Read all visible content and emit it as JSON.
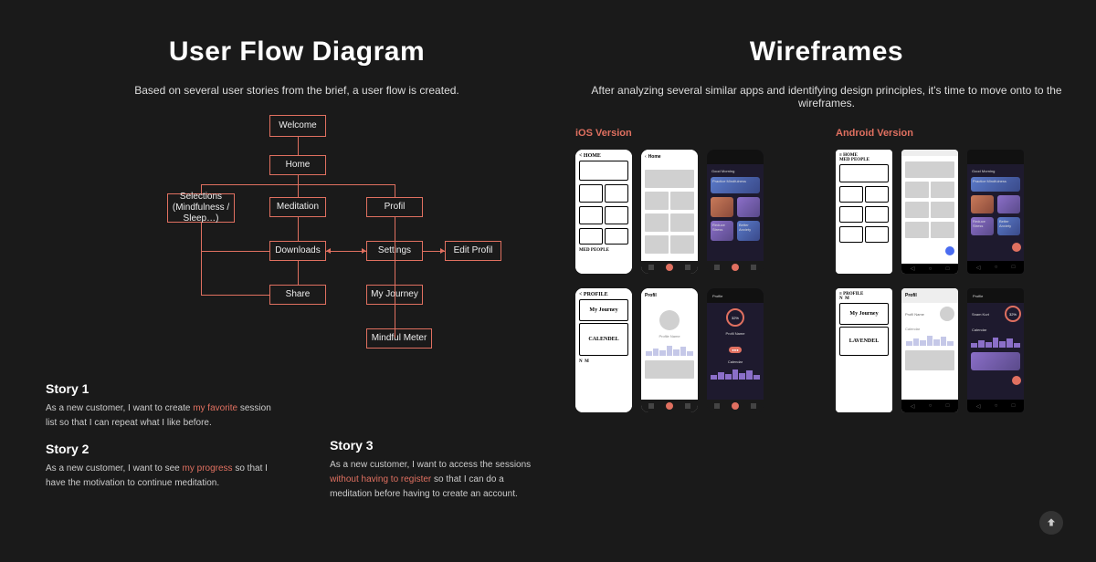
{
  "left": {
    "title": "User Flow Diagram",
    "subtitle": "Based on several user stories from the brief, a user flow is created.",
    "nodes": {
      "welcome": "Welcome",
      "home": "Home",
      "selections": "Selections (Mindfulness / Sleep…)",
      "meditation": "Meditation",
      "downloads": "Downloads",
      "share": "Share",
      "profil": "Profil",
      "settings": "Settings",
      "my_journey": "My Journey",
      "mindful_meter": "Mindful Meter",
      "edit_profil": "Edit Profil"
    },
    "stories": [
      {
        "title": "Story 1",
        "pre": "As a new customer, I want to create ",
        "hl": "my favorite",
        "post": " session list so that I can repeat what I like before."
      },
      {
        "title": "Story 2",
        "pre": "As a new customer, I want to see ",
        "hl": "my progress",
        "post": " so that I have the motivation to continue meditation."
      },
      {
        "title": "Story 3",
        "pre": "As a new customer, I want to access the sessions ",
        "hl": "without having to register",
        "post": " so that I can do a meditation before having to create an account."
      }
    ]
  },
  "right": {
    "title": "Wireframes",
    "subtitle": "After analyzing several similar apps and identifying design principles, it's time to move onto to the wireframes.",
    "ios_label": "iOS Version",
    "android_label": "Android Version",
    "sketch": {
      "home": "< HOME",
      "med": "MED",
      "people": "PEOPLE",
      "profile": "< PROFILE",
      "my_journey": "My Journey",
      "calendel": "CALENDEL",
      "hamburger_home": "≡ HOME",
      "profile_row": "≡ PROFILE",
      "lavendel": "LAVENDEL",
      "n": "N",
      "m": "M"
    },
    "lofi": {
      "home": "Home",
      "profil": "Profil",
      "profile_name": "Profile Name"
    },
    "hifi": {
      "good_morning": "Good Morning",
      "practice": "Practice Mindfulness",
      "reduce": "Reduce Stress",
      "better": "Better Anxiety",
      "profile": "Profile",
      "profil_name": "Profil Name",
      "calendar": "Calendar",
      "snam": "Snam Kurt",
      "pct": "32%"
    }
  },
  "scroll_top_label": "Scroll to top"
}
